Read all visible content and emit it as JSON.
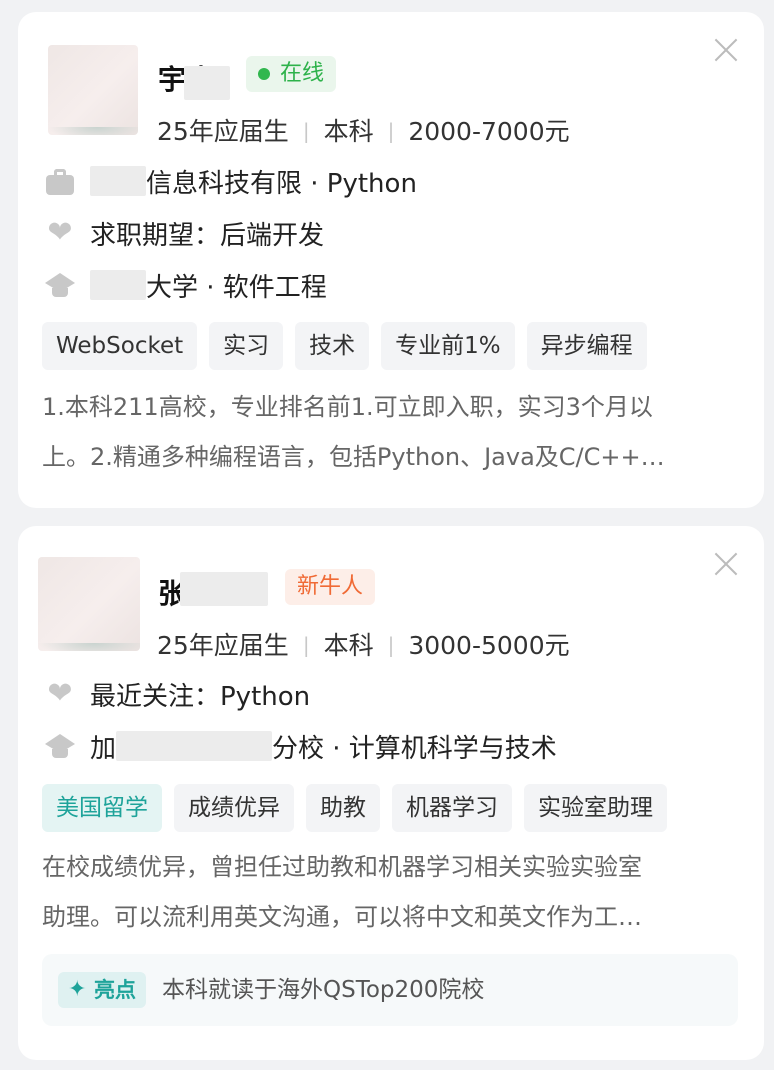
{
  "cards": [
    {
      "name": "宇山",
      "status_badge": "在线",
      "meta": {
        "graduation": "25年应届生",
        "degree": "本科",
        "salary": "2000-7000元"
      },
      "experience": "信息科技有限 · Python",
      "expectation": "求职期望：后端开发",
      "school_prefix": "",
      "school": "大学 · 软件工程",
      "tags": [
        "WebSocket",
        "实习",
        "技术",
        "专业前1%",
        "异步编程"
      ],
      "description_lines": [
        "1.本科211高校，专业排名前1.可立即入职，实习3个月以",
        "上。2.精通多种编程语言，包括Python、Java及C/C++…"
      ],
      "icons": {
        "experience": "briefcase-icon",
        "expectation": "heart-icon",
        "school": "graduation-cap-icon",
        "close": "close-icon"
      }
    },
    {
      "name": "张",
      "status_badge": "新牛人",
      "meta": {
        "graduation": "25年应届生",
        "degree": "本科",
        "salary": "3000-5000元"
      },
      "recent_focus": "最近关注：Python",
      "school_prefix": "加",
      "school": "分校 · 计算机科学与技术",
      "tags": [
        "美国留学",
        "成绩优异",
        "助教",
        "机器学习",
        "实验室助理"
      ],
      "description_lines": [
        "在校成绩优异，曾担任过助教和机器学习相关实验实验室",
        "助理。可以流利用英文沟通，可以将中文和英文作为工…"
      ],
      "highlight": {
        "label": "亮点",
        "text": "本科就读于海外QSTop200院校"
      },
      "icons": {
        "recent_focus": "heart-icon",
        "school": "graduation-cap-icon",
        "highlight": "sparkle-icon",
        "close": "close-icon"
      }
    }
  ],
  "colors": {
    "online_green": "#2db24a",
    "newbie_orange": "#f06a35",
    "highlight_teal": "#1ea39a"
  }
}
